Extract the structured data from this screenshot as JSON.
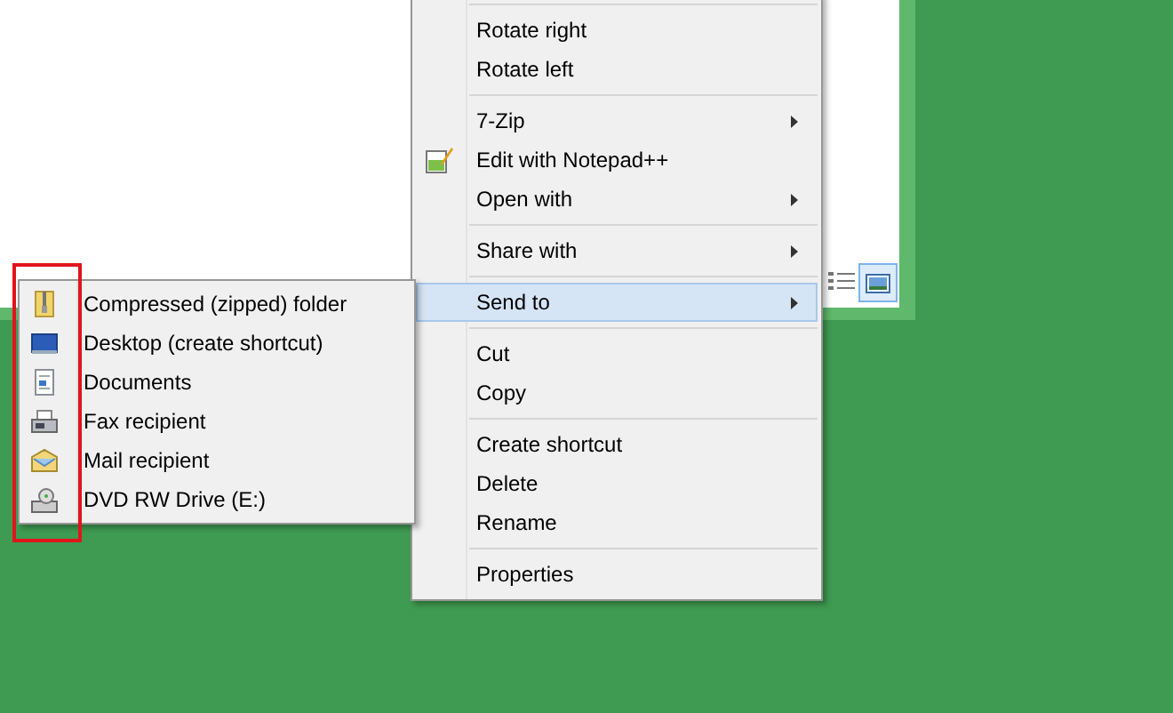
{
  "context_menu": {
    "items": [
      {
        "kind": "separator"
      },
      {
        "kind": "item",
        "label": "Rotate right",
        "submenu": false,
        "selected": false
      },
      {
        "kind": "item",
        "label": "Rotate left",
        "submenu": false,
        "selected": false
      },
      {
        "kind": "separator"
      },
      {
        "kind": "item",
        "label": "7-Zip",
        "submenu": true,
        "selected": false
      },
      {
        "kind": "icon_item",
        "label": "Edit with Notepad++",
        "submenu": false,
        "selected": false
      },
      {
        "kind": "item",
        "label": "Open with",
        "submenu": true,
        "selected": false
      },
      {
        "kind": "separator"
      },
      {
        "kind": "item",
        "label": "Share with",
        "submenu": true,
        "selected": false
      },
      {
        "kind": "separator"
      },
      {
        "kind": "item",
        "label": "Send to",
        "submenu": true,
        "selected": true
      },
      {
        "kind": "separator"
      },
      {
        "kind": "item",
        "label": "Cut",
        "submenu": false,
        "selected": false
      },
      {
        "kind": "item",
        "label": "Copy",
        "submenu": false,
        "selected": false
      },
      {
        "kind": "separator"
      },
      {
        "kind": "item",
        "label": "Create shortcut",
        "submenu": false,
        "selected": false
      },
      {
        "kind": "item",
        "label": "Delete",
        "submenu": false,
        "selected": false
      },
      {
        "kind": "item",
        "label": "Rename",
        "submenu": false,
        "selected": false
      },
      {
        "kind": "separator"
      },
      {
        "kind": "item",
        "label": "Properties",
        "submenu": false,
        "selected": false
      }
    ]
  },
  "send_to_menu": {
    "items": [
      {
        "kind": "zip",
        "label": "Compressed (zipped) folder"
      },
      {
        "kind": "desktop",
        "label": "Desktop (create shortcut)"
      },
      {
        "kind": "documents",
        "label": "Documents"
      },
      {
        "kind": "fax",
        "label": "Fax recipient"
      },
      {
        "kind": "mail",
        "label": "Mail recipient"
      },
      {
        "kind": "dvd",
        "label": "DVD RW Drive (E:)"
      }
    ]
  }
}
